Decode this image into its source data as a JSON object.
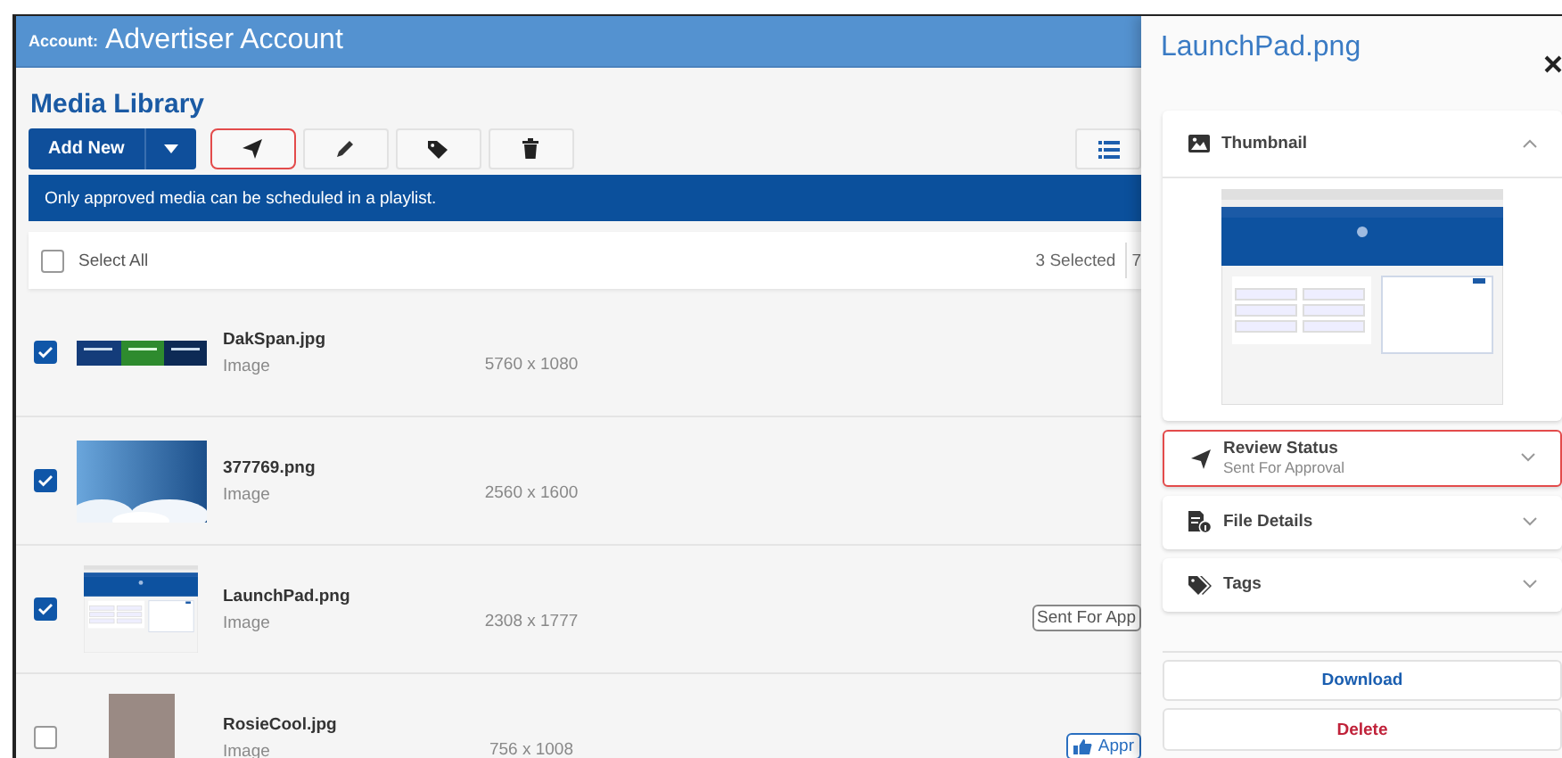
{
  "header": {
    "label": "Account:",
    "account": "Advertiser Account"
  },
  "page_title": "Media Library",
  "toolbar": {
    "add_button": "Add New",
    "actions": [
      {
        "kind": "send",
        "highlighted": true
      },
      {
        "kind": "edit",
        "highlighted": false
      },
      {
        "kind": "tag",
        "highlighted": false
      },
      {
        "kind": "delete",
        "highlighted": false
      }
    ]
  },
  "notice": "Only approved media can be scheduled in a playlist.",
  "select_all": {
    "label": "Select All",
    "checked": false,
    "selected_count": "3 Selected",
    "column_2": "7"
  },
  "media": [
    {
      "name": "DakSpan.jpg",
      "type": "Image",
      "dimensions": "5760 x 1080",
      "kind": "banner",
      "checked": true
    },
    {
      "name": "377769.png",
      "type": "Image",
      "dimensions": "2560 x 1600",
      "kind": "sky",
      "checked": true
    },
    {
      "name": "LaunchPad.png",
      "type": "Image",
      "dimensions": "2308 x 1777",
      "kind": "screenshot",
      "checked": true,
      "status": {
        "kind": "pending",
        "label": "Sent For App"
      }
    },
    {
      "name": "RosieCool.jpg",
      "type": "Image",
      "dimensions": "756 x 1008",
      "kind": "photo",
      "checked": false,
      "status": {
        "kind": "approved",
        "label": "Appr"
      }
    }
  ],
  "panel": {
    "title": "LaunchPad.png",
    "sections": [
      {
        "kind": "thumbnail",
        "title": "Thumbnail",
        "expanded": true,
        "highlighted": false
      },
      {
        "kind": "review",
        "title": "Review Status",
        "subtitle": "Sent For Approval",
        "expanded": false,
        "highlighted": true
      },
      {
        "kind": "details",
        "title": "File Details",
        "expanded": false,
        "highlighted": false
      },
      {
        "kind": "tags",
        "title": "Tags",
        "expanded": false,
        "highlighted": false
      }
    ],
    "buttons": [
      {
        "kind": "download",
        "label": "Download"
      },
      {
        "kind": "delete",
        "label": "Delete"
      }
    ]
  }
}
